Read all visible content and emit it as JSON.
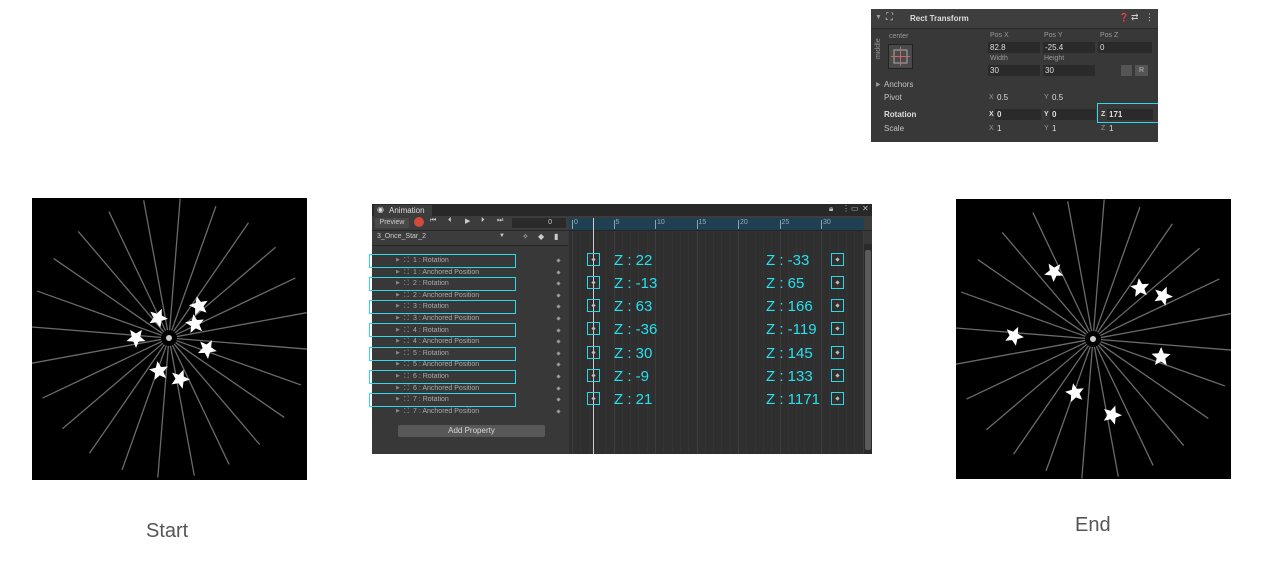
{
  "captions": {
    "start": "Start",
    "end": "End"
  },
  "inspector": {
    "title": "Rect Transform",
    "anchor_h": "center",
    "anchor_v": "middle",
    "pos_x_label": "Pos X",
    "pos_y_label": "Pos Y",
    "pos_z_label": "Pos Z",
    "pos_x": "82.8",
    "pos_y": "-25.4",
    "pos_z": "0",
    "width_label": "Width",
    "height_label": "Height",
    "width": "30",
    "height": "30",
    "anchors_label": "Anchors",
    "pivot_label": "Pivot",
    "pivot_x_label": "X",
    "pivot_x": "0.5",
    "pivot_y_label": "Y",
    "pivot_y": "0.5",
    "rotation_label": "Rotation",
    "rot_x_label": "X",
    "rot_x": "0",
    "rot_y_label": "Y",
    "rot_y": "0",
    "rot_z_label": "Z",
    "rot_z": "171",
    "scale_label": "Scale",
    "scale_x_label": "X",
    "scale_x": "1",
    "scale_y_label": "Y",
    "scale_y": "1",
    "scale_z_label": "Z",
    "scale_z": "1",
    "button_r": "R"
  },
  "animation": {
    "tab": "Animation",
    "preview": "Preview",
    "frame": "0",
    "clip": "3_Once_Star_2",
    "ruler_ticks": [
      "0",
      "5",
      "10",
      "15",
      "20",
      "25",
      "30"
    ],
    "properties": [
      "1 : Rotation",
      "1 : Anchored Position",
      "2 : Rotation",
      "2 : Anchored Position",
      "3 : Rotation",
      "3 : Anchored Position",
      "4 : Rotation",
      "4 : Anchored Position",
      "5 : Rotation",
      "5 : Anchored Position",
      "6 : Rotation",
      "6 : Anchored Position",
      "7 : Rotation",
      "7 : Anchored Position"
    ],
    "add_property": "Add Property",
    "start_z": [
      "Z : 22",
      "Z : -13",
      "Z : 63",
      "Z : -36",
      "Z : 30",
      "Z : -9",
      "Z : 21"
    ],
    "end_z": [
      "Z : -33",
      "Z : 65",
      "Z : 166",
      "Z : -119",
      "Z : 145",
      "Z : 133",
      "Z : 1171"
    ]
  },
  "colors": {
    "highlight": "#2fd8e8",
    "label": "#29e0f0",
    "ray": "#6a6a6a",
    "star": "#ffffff"
  }
}
